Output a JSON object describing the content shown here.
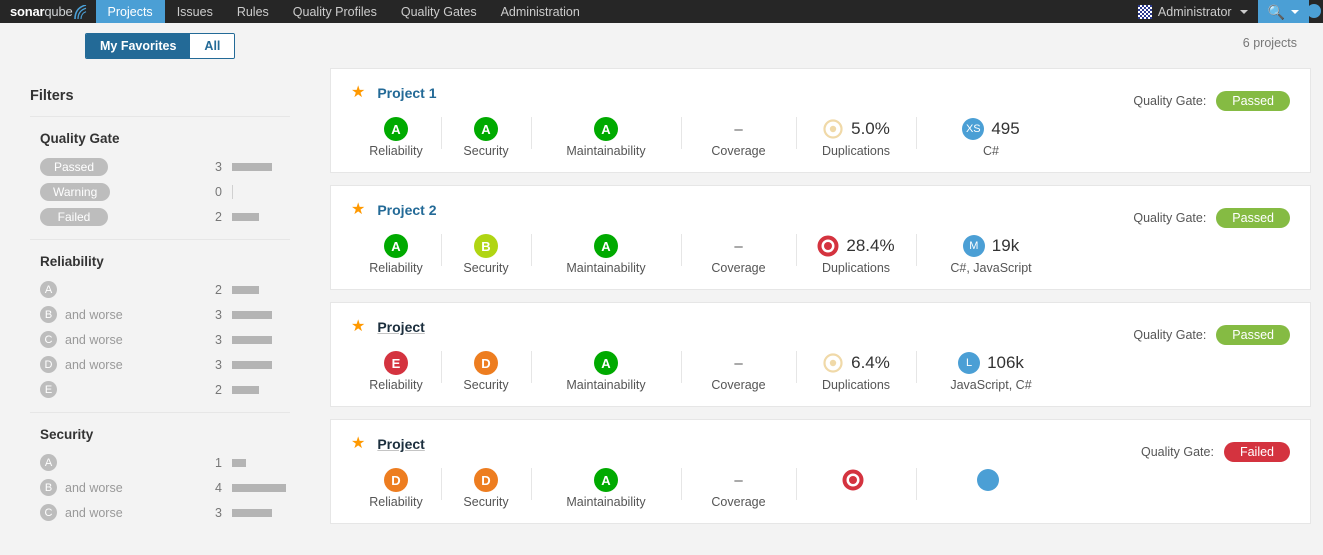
{
  "navbar": {
    "logo_bold": "sonar",
    "logo_light": "qube",
    "items": [
      {
        "label": "Projects",
        "active": true
      },
      {
        "label": "Issues",
        "active": false
      },
      {
        "label": "Rules",
        "active": false
      },
      {
        "label": "Quality Profiles",
        "active": false
      },
      {
        "label": "Quality Gates",
        "active": false
      },
      {
        "label": "Administration",
        "active": false
      }
    ],
    "user": "Administrator",
    "search_icon": "search-icon"
  },
  "toolbar": {
    "my_favorites": "My Favorites",
    "all": "All",
    "projects_count": "6 projects"
  },
  "sidebar": {
    "title": "Filters",
    "facets": [
      {
        "name": "Quality Gate",
        "kind": "pill",
        "rows": [
          {
            "label": "Passed",
            "count": "3",
            "bar": 40
          },
          {
            "label": "Warning",
            "count": "0",
            "bar": 0
          },
          {
            "label": "Failed",
            "count": "2",
            "bar": 27
          }
        ]
      },
      {
        "name": "Reliability",
        "kind": "rating",
        "rows": [
          {
            "label": "A",
            "suffix": "",
            "count": "2",
            "bar": 27
          },
          {
            "label": "B",
            "suffix": "and worse",
            "count": "3",
            "bar": 40
          },
          {
            "label": "C",
            "suffix": "and worse",
            "count": "3",
            "bar": 40
          },
          {
            "label": "D",
            "suffix": "and worse",
            "count": "3",
            "bar": 40
          },
          {
            "label": "E",
            "suffix": "",
            "count": "2",
            "bar": 27
          }
        ]
      },
      {
        "name": "Security",
        "kind": "rating",
        "rows": [
          {
            "label": "A",
            "suffix": "",
            "count": "1",
            "bar": 14
          },
          {
            "label": "B",
            "suffix": "and worse",
            "count": "4",
            "bar": 54
          },
          {
            "label": "C",
            "suffix": "and worse",
            "count": "3",
            "bar": 40
          }
        ]
      }
    ]
  },
  "colors": {
    "rating_A": "#00aa00",
    "rating_B": "#b0d513",
    "rating_C": "#eabe06",
    "rating_D": "#ed7d20",
    "rating_E": "#d4333f",
    "passed": "#85bb43",
    "failed": "#d4333f",
    "accent": "#4b9fd5",
    "link": "#236a97",
    "star": "#ff9900",
    "dup_low": "#f0d9a8",
    "dup_high": "#d4333f"
  },
  "measure_labels": {
    "reliability": "Reliability",
    "security": "Security",
    "maintainability": "Maintainability",
    "coverage": "Coverage",
    "duplications": "Duplications"
  },
  "projects": [
    {
      "name": "Project 1",
      "hovered": false,
      "quality_gate_label": "Quality Gate:",
      "quality_gate": "Passed",
      "reliability": "A",
      "security": "A",
      "maintainability": "A",
      "coverage": "–",
      "duplications": "5.0%",
      "duplications_level": "low",
      "size_badge": "XS",
      "size_value": "495",
      "languages": "C#"
    },
    {
      "name": "Project  2",
      "hovered": false,
      "quality_gate_label": "Quality Gate:",
      "quality_gate": "Passed",
      "reliability": "A",
      "security": "B",
      "maintainability": "A",
      "coverage": "–",
      "duplications": "28.4%",
      "duplications_level": "high",
      "size_badge": "M",
      "size_value": "19k",
      "languages": "C#, JavaScript"
    },
    {
      "name": "Project",
      "hovered": true,
      "quality_gate_label": "Quality Gate:",
      "quality_gate": "Passed",
      "reliability": "E",
      "security": "D",
      "maintainability": "A",
      "coverage": "–",
      "duplications": "6.4%",
      "duplications_level": "low",
      "size_badge": "L",
      "size_value": "106k",
      "languages": "JavaScript, C#"
    },
    {
      "name": "Project",
      "hovered": true,
      "quality_gate_label": "Quality Gate:",
      "quality_gate": "Failed",
      "reliability": "D",
      "security": "D",
      "maintainability": "A",
      "coverage": "–",
      "duplications": "",
      "duplications_level": "high",
      "size_badge": "",
      "size_value": "",
      "languages": ""
    }
  ]
}
